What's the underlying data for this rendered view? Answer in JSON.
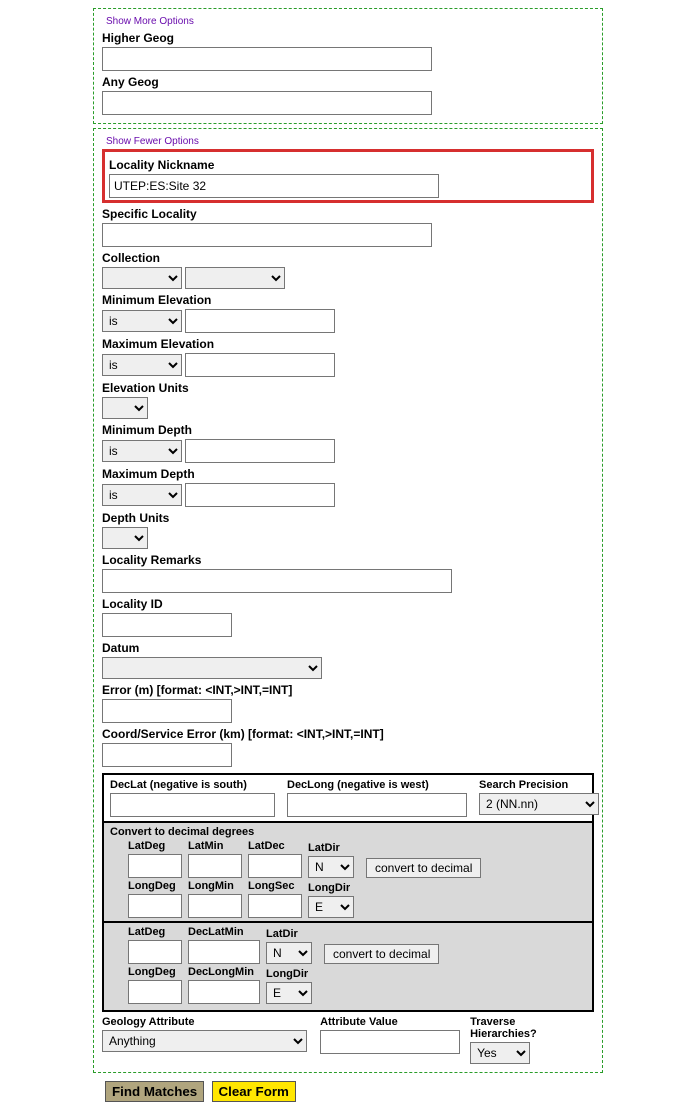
{
  "section1": {
    "show_more": "Show More Options",
    "higher_geog_label": "Higher Geog",
    "higher_geog_value": "",
    "any_geog_label": "Any Geog",
    "any_geog_value": ""
  },
  "section2": {
    "show_fewer": "Show Fewer Options",
    "locality_nickname_label": "Locality Nickname",
    "locality_nickname_value": "UTEP:ES:Site 32",
    "specific_locality_label": "Specific Locality",
    "specific_locality_value": "",
    "collection_label": "Collection",
    "min_elevation_label": "Minimum Elevation",
    "min_elevation_op": "is",
    "min_elevation_value": "",
    "max_elevation_label": "Maximum Elevation",
    "max_elevation_op": "is",
    "max_elevation_value": "",
    "elevation_units_label": "Elevation Units",
    "min_depth_label": "Minimum Depth",
    "min_depth_op": "is",
    "min_depth_value": "",
    "max_depth_label": "Maximum Depth",
    "max_depth_op": "is",
    "max_depth_value": "",
    "depth_units_label": "Depth Units",
    "locality_remarks_label": "Locality Remarks",
    "locality_remarks_value": "",
    "locality_id_label": "Locality ID",
    "locality_id_value": "",
    "datum_label": "Datum",
    "error_label": "Error (m) [format: <INT,>INT,=INT]",
    "error_value": "",
    "coord_error_label": "Coord/Service Error (km) [format: <INT,>INT,=INT]",
    "coord_error_value": ""
  },
  "coords": {
    "declat_label": "DecLat (negative is south)",
    "declong_label": "DecLong (negative is west)",
    "search_precision_label": "Search Precision",
    "search_precision_value": "2 (NN.nn)",
    "convert_header": "Convert to decimal degrees",
    "latdeg": "LatDeg",
    "latmin": "LatMin",
    "latdec": "LatDec",
    "latdir": "LatDir",
    "longdeg": "LongDeg",
    "longmin": "LongMin",
    "longsec": "LongSec",
    "longdir": "LongDir",
    "declatmin": "DecLatMin",
    "declongmin": "DecLongMin",
    "n": "N",
    "e": "E",
    "convert_btn": "convert to decimal"
  },
  "geology": {
    "attr_label": "Geology Attribute",
    "attr_value": "Anything",
    "val_label": "Attribute Value",
    "trav_label": "Traverse Hierarchies?",
    "trav_value": "Yes"
  },
  "buttons": {
    "find": "Find Matches",
    "clear": "Clear Form"
  }
}
